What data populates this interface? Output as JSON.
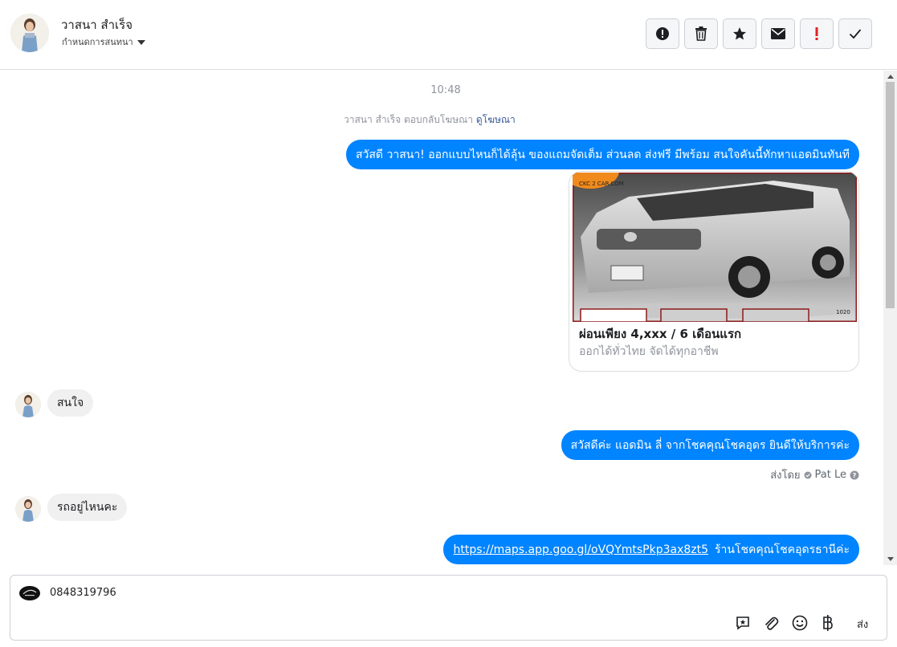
{
  "header": {
    "name": "วาสนา สำเร็จ",
    "assign_label": "กำหนดการสนทนา",
    "buttons": [
      {
        "name": "spam-button",
        "icon": "exclamation-circle-icon"
      },
      {
        "name": "delete-button",
        "icon": "trash-icon"
      },
      {
        "name": "star-button",
        "icon": "star-icon"
      },
      {
        "name": "mark-unread-button",
        "icon": "envelope-icon"
      },
      {
        "name": "important-button",
        "icon": "red-exclamation-icon"
      },
      {
        "name": "done-button",
        "icon": "check-icon"
      }
    ]
  },
  "chat": {
    "timestamp": "10:48",
    "ad_reply_text": "วาสนา สำเร็จ ตอบกลับโฆษณา",
    "ad_view_link": "ดูโฆษณา",
    "messages": [
      {
        "from": "page",
        "text": "สวัสดี วาสนา! ออกแบบไหนก็ได้ลุ้น ของแถมจัดเต็ม ส่วนลด ส่งฟรี มีพร้อม สนใจคันนี้ทักหาแอดมินทันที"
      },
      {
        "from": "page",
        "type": "card",
        "image_logo": "CKC 2 CAR.COM",
        "image_code": "1020",
        "title": "ผ่อนเพียง 4,xxx / 6 เดือนแรก",
        "subtitle": "ออกได้ทั่วไทย จัดได้ทุกอาชีพ"
      },
      {
        "from": "user",
        "text": "สนใจ"
      },
      {
        "from": "page",
        "text": "สวัสดีค่ะ แอดมิน ลี่ จากโชคคุณโชคอุดร ยินดีให้บริการค่ะ"
      },
      {
        "from": "user",
        "text": "รถอยู่ไหนคะ"
      },
      {
        "from": "page",
        "link": "https://maps.app.goo.gl/oVQYmtsPkp3ax8zt5",
        "text": "ร้านโชคคุณโชคอุดรธานีค่ะ"
      }
    ],
    "sent_by_label": "ส่งโดย",
    "sent_by_name": "Pat Le"
  },
  "composer": {
    "value": "0848319796",
    "send_label": "ส่ง",
    "icons": [
      "quick-reply-icon",
      "attachment-icon",
      "emoji-icon",
      "baht-icon"
    ]
  },
  "colors": {
    "accent": "#0084ff",
    "incoming_bubble": "#f1f0f0",
    "important_red": "#e02020"
  }
}
